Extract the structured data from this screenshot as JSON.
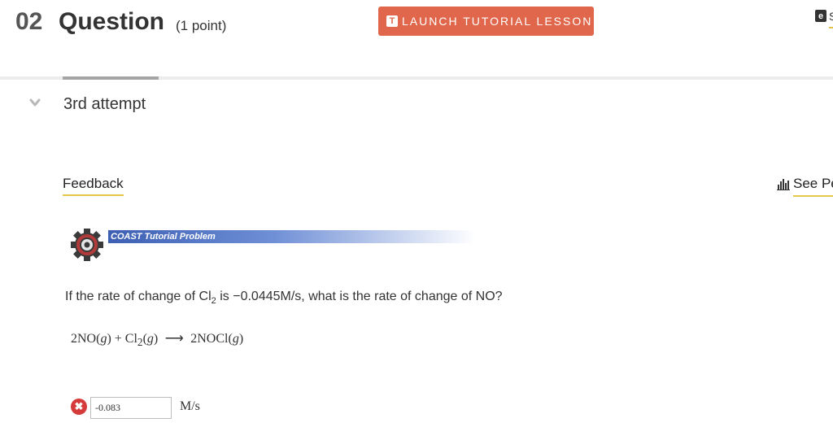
{
  "header": {
    "question_number": "02",
    "question_title": "Question",
    "question_points": "(1 point)",
    "tutorial_icon": "T",
    "tutorial_button_label": "LAUNCH TUTORIAL LESSON",
    "ebook_icon_glyph": "e",
    "ebook_icon": "ebook-icon",
    "ebook_label_fragment": "S"
  },
  "attempt": {
    "label": "3rd attempt",
    "chevron_icon": "chevron-down-icon"
  },
  "feedback": {
    "label": "Feedback"
  },
  "performance": {
    "icon": "bar-chart-icon",
    "label": "See Pe"
  },
  "tutorial_banner": {
    "label": "COAST Tutorial Problem",
    "icon": "gear-icon"
  },
  "question": {
    "text_before": "If the rate of change of Cl",
    "text_sub": "2",
    "text_after": " is −0.0445M/s, what is the rate of change of NO?",
    "equation": {
      "lhs1": "2NO(",
      "lhs1_state": "g",
      "lhs1_close": ")",
      "plus": " + ",
      "lhs2": "Cl",
      "lhs2_sub": "2",
      "lhs2_open": "(",
      "lhs2_state": "g",
      "lhs2_close": ")",
      "arrow": "⟶",
      "rhs": "2NOCl(",
      "rhs_state": "g",
      "rhs_close": ")"
    }
  },
  "answer": {
    "value": "-0.083",
    "unit": "M/s",
    "status_icon": "error-x-icon",
    "status_glyph": "✖"
  },
  "colors": {
    "accent": "#e0674b",
    "underline": "#e8c84a",
    "error": "#d63b3b",
    "banner": "#3c5fb3"
  }
}
